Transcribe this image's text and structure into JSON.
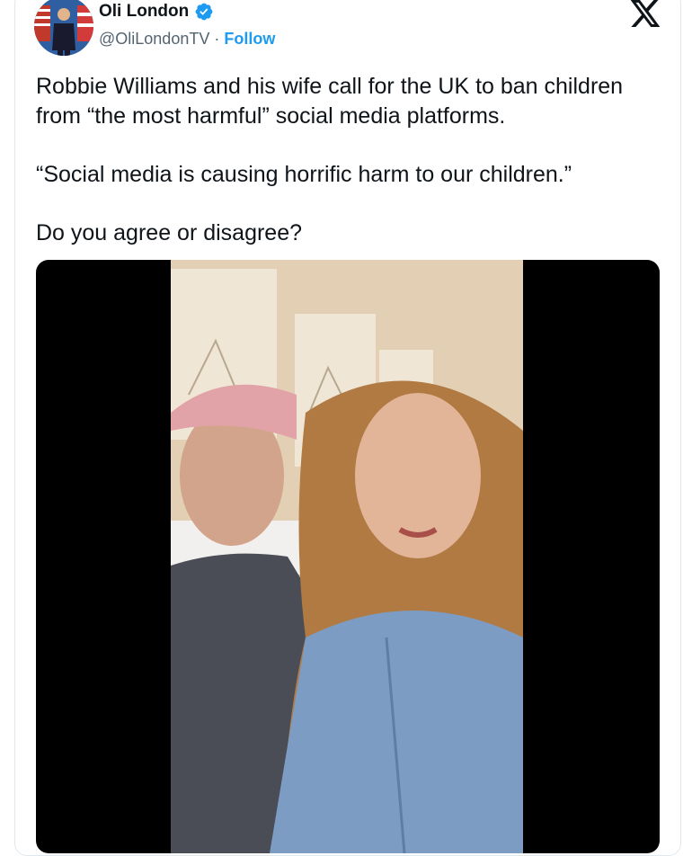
{
  "author": {
    "display_name": "Oli London",
    "handle": "@OliLondonTV",
    "separator": "·",
    "follow_label": "Follow",
    "verified": true
  },
  "tweet": {
    "paragraphs": [
      "Robbie Williams and his wife call for the UK to ban children from “the most harmful” social media platforms.",
      "“Social media is causing horrific harm to our children.”",
      "Do you agree or disagree?"
    ]
  },
  "media": {
    "type": "video",
    "letterbox_color": "#000000"
  },
  "icons": {
    "brand": "x-logo-icon",
    "verified": "verified-badge-icon"
  },
  "colors": {
    "accent": "#1d9bf0",
    "text_primary": "#0f1419",
    "text_secondary": "#536471",
    "border": "#e1e8ed"
  }
}
